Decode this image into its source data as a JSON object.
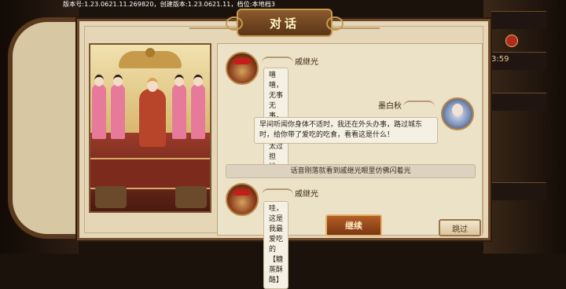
{
  "version_text": "版本号:1.23.0621.11.269820，创建版本:1.23.0621.11，档位:本地档3",
  "dialog": {
    "title": "对话"
  },
  "messages": [
    {
      "speaker": "戚继光",
      "text": "嘻嘻，无事无事，夫君不用太过担忧。",
      "side": "left",
      "avatar": "general-portrait-icon"
    },
    {
      "speaker": "墨白秋",
      "text": "早间听闻你身体不适时，我还在外头办事，路过城东时，给你带了爱吃的吃食，看看这是什么！",
      "side": "right",
      "avatar": "scholar-portrait-icon"
    },
    {
      "speaker": "戚继光",
      "text": "哇，这是我最爱吃的【糖蒸酥酪】",
      "side": "left",
      "avatar": "general-portrait-icon"
    }
  ],
  "narration": "话音刚落就看到戚继光眼里仿佛闪着光",
  "buttons": {
    "continue": "继续",
    "skip": "跳过"
  },
  "background": {
    "counter_text": "3:59"
  }
}
